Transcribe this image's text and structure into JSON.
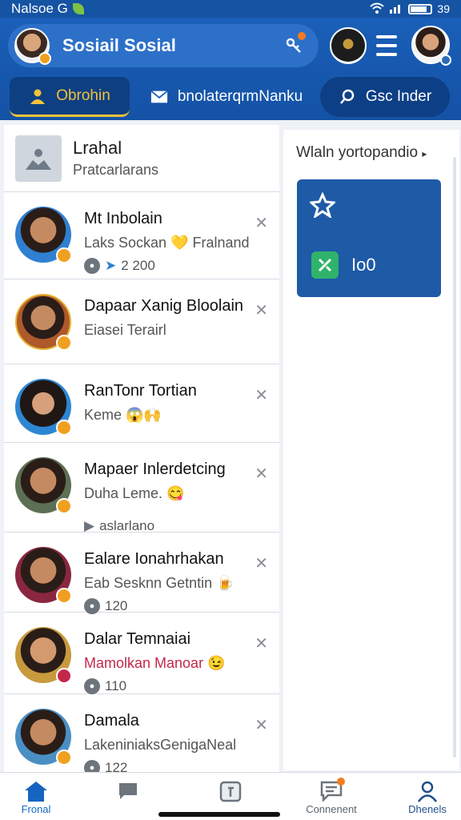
{
  "status_bar": {
    "left_text": "Nalsoe G",
    "right_text": "39"
  },
  "header": {
    "app_title": "Sosiail Sosial",
    "tabs": [
      {
        "label": "Obrohin",
        "icon": "person-icon"
      },
      {
        "label": "bnolaterqrmNanku",
        "icon": "mail-icon"
      },
      {
        "label": "Gsc Inder",
        "icon": "search-icon"
      }
    ]
  },
  "top_card": {
    "title": "Lrahal",
    "subtitle": "Pratcarlarans"
  },
  "contacts": [
    {
      "name": "Mt Inbolain",
      "subtitle": "Laks Sockan 💛 Fralnand",
      "meta": "2 200",
      "subtitle_red": false
    },
    {
      "name": "Dapaar Xanig Bloolain",
      "subtitle": "Eiasei Terairl",
      "meta": "",
      "subtitle_red": false
    },
    {
      "name": "RanTonr Tortian",
      "subtitle": "Keme 😱🙌",
      "meta": "",
      "subtitle_red": false
    },
    {
      "name": "Mapaer Inlerdetcing",
      "subtitle": "Duha Leme. 😋",
      "meta": "aslarlano",
      "subtitle_red": false
    },
    {
      "name": "Ealare Ionahrhakan",
      "subtitle": "Eab Sesknn Getntin 🍺",
      "meta": "120",
      "subtitle_red": false
    },
    {
      "name": "Dalar Temnaiai",
      "subtitle": "Mamolkan Manoar 😉",
      "meta": "110",
      "subtitle_red": true
    },
    {
      "name": "Damala",
      "subtitle": "LakeniniaksGenigaNeal",
      "meta": "122",
      "subtitle_red": false
    }
  ],
  "right_panel": {
    "label": "Wlaln yortopandio",
    "tile_value": "Io0"
  },
  "bottom_nav": [
    {
      "label": "Fronal",
      "icon": "home-icon"
    },
    {
      "label": "",
      "icon": "chat-icon"
    },
    {
      "label": "",
      "icon": "calendar-icon"
    },
    {
      "label": "Connenent",
      "icon": "comment-icon"
    },
    {
      "label": "Dhenels",
      "icon": "profile-icon"
    }
  ],
  "colors": {
    "primary": "#1a5fb8",
    "accent": "#f2c23c",
    "tile": "#2fb36b"
  }
}
